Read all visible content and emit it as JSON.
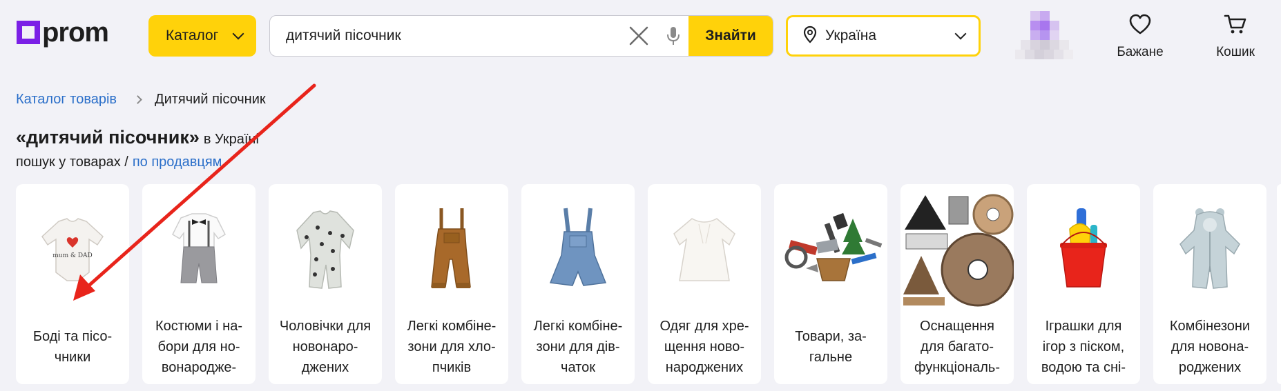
{
  "header": {
    "logo_text": "prom",
    "catalog_label": "Каталог",
    "search": {
      "value": "дитячий пісочник",
      "button_label": "Знайти"
    },
    "region_label": "Україна",
    "wishlist_label": "Бажане",
    "cart_label": "Кошик"
  },
  "breadcrumb": {
    "root": "Каталог товарів",
    "current": "Дитячий пісочник"
  },
  "title": {
    "query": "«дитячий пісочник»",
    "suffix": "в Україні"
  },
  "search_mode": {
    "active": "пошук у товарах /",
    "link": "по продавцям"
  },
  "categories": [
    {
      "label": "Боді та пісо-\nчники"
    },
    {
      "label": "Костюми і на-\nбори для но-\nвонародже-"
    },
    {
      "label": "Чоловічки для\nновонаро-\nджених"
    },
    {
      "label": "Легкі комбіне-\nзони для хло-\nпчиків"
    },
    {
      "label": "Легкі комбіне-\nзони для дів-\nчаток"
    },
    {
      "label": "Одяг для хре-\nщення ново-\nнароджених"
    },
    {
      "label": "Товари, за-\nгальне"
    },
    {
      "label": "Оснащення\nдля багато-\nфункціональ-"
    },
    {
      "label": "Іграшки для\nігор з піском,\nводою та сні-"
    },
    {
      "label": "Комбінезони\nдля новона-\nроджених"
    }
  ],
  "colors": {
    "accent": "#ffd20a",
    "brand": "#7b20e6",
    "link": "#2b6fc9",
    "annotation": "#e8241b"
  }
}
